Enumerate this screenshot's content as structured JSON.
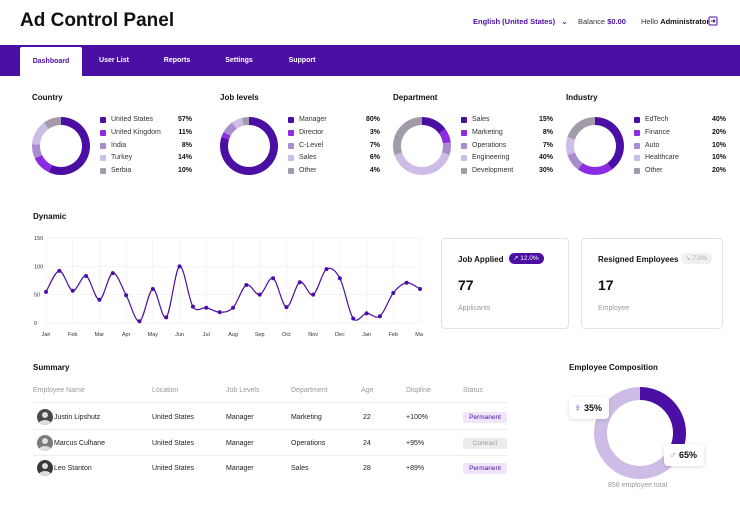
{
  "header": {
    "title": "Ad Control Panel",
    "language": "English (United States)",
    "balance_label": "Balance",
    "balance_value": "$0.00",
    "hello_label": "Hello",
    "user_name": "Administrator"
  },
  "nav": {
    "tabs": [
      {
        "label": "Dashboard",
        "active": true
      },
      {
        "label": "User List",
        "active": false
      },
      {
        "label": "Reports",
        "active": false
      },
      {
        "label": "Settings",
        "active": false
      },
      {
        "label": "Support",
        "active": false
      }
    ]
  },
  "colors": {
    "brand": "#4b0fa3",
    "c1": "#4b0fa3",
    "c2": "#8b2be2",
    "c3": "#a98bd0",
    "c4": "#cdbde6",
    "c5": "#a39ca8",
    "permanent_bg": "#efe6fb",
    "contract_bg": "#ececec"
  },
  "donuts": [
    {
      "title": "Country",
      "items": [
        {
          "label": "United States",
          "pct": "57%",
          "value": 57
        },
        {
          "label": "United Kingdom",
          "pct": "11%",
          "value": 11
        },
        {
          "label": "India",
          "pct": "8%",
          "value": 8
        },
        {
          "label": "Turkey",
          "pct": "14%",
          "value": 14
        },
        {
          "label": "Serbia",
          "pct": "10%",
          "value": 10
        }
      ]
    },
    {
      "title": "Job levels",
      "items": [
        {
          "label": "Manager",
          "pct": "80%",
          "value": 80
        },
        {
          "label": "Director",
          "pct": "3%",
          "value": 3
        },
        {
          "label": "C-Level",
          "pct": "7%",
          "value": 7
        },
        {
          "label": "Sales",
          "pct": "6%",
          "value": 6
        },
        {
          "label": "Other",
          "pct": "4%",
          "value": 4
        }
      ]
    },
    {
      "title": "Department",
      "items": [
        {
          "label": "Sales",
          "pct": "15%",
          "value": 15
        },
        {
          "label": "Marketing",
          "pct": "8%",
          "value": 8
        },
        {
          "label": "Operations",
          "pct": "7%",
          "value": 7
        },
        {
          "label": "Engineering",
          "pct": "40%",
          "value": 40
        },
        {
          "label": "Development",
          "pct": "30%",
          "value": 30
        }
      ]
    },
    {
      "title": "Industry",
      "items": [
        {
          "label": "EdTech",
          "pct": "40%",
          "value": 40
        },
        {
          "label": "Finance",
          "pct": "20%",
          "value": 20
        },
        {
          "label": "Auto",
          "pct": "10%",
          "value": 10
        },
        {
          "label": "Healthcare",
          "pct": "10%",
          "value": 10
        },
        {
          "label": "Other",
          "pct": "20%",
          "value": 20
        }
      ]
    }
  ],
  "chart_data": {
    "type": "line",
    "title": "Dynamic",
    "ylim": [
      0,
      150
    ],
    "yticks": [
      "150",
      "100",
      "50",
      "0"
    ],
    "xticks": [
      "Jan",
      "Feb",
      "Mar",
      "Apr",
      "May",
      "Jun",
      "Jul",
      "Aug",
      "Sep",
      "Oct",
      "Nov",
      "Dec",
      "Jan",
      "Feb",
      "Mar"
    ],
    "series": [
      {
        "values": [
          55,
          92,
          57,
          83,
          41,
          88,
          49,
          3,
          60,
          10,
          100,
          29,
          27,
          19,
          27,
          67,
          50,
          79,
          28,
          72,
          50,
          95,
          79,
          8,
          17,
          12,
          53,
          71,
          60
        ]
      }
    ]
  },
  "cards": {
    "job_applied": {
      "title": "Job Applied",
      "badge": "12.0%",
      "value": "77",
      "sub": "Applicants"
    },
    "resigned": {
      "title": "Resigned Employees",
      "badge": "7.0%",
      "value": "17",
      "sub": "Employee"
    }
  },
  "summary": {
    "title": "Summary",
    "columns": [
      "Employee Name",
      "Location",
      "Job Levels",
      "Department",
      "Age",
      "Displine",
      "Status"
    ],
    "rows": [
      {
        "name": "Justin Lipshutz",
        "location": "United States",
        "level": "Manager",
        "department": "Marketing",
        "age": "22",
        "discipline": "+100%",
        "status": "Permanent"
      },
      {
        "name": "Marcus Culhane",
        "location": "United States",
        "level": "Manager",
        "department": "Operations",
        "age": "24",
        "discipline": "+95%",
        "status": "Contract"
      },
      {
        "name": "Leo Stanton",
        "location": "United States",
        "level": "Manager",
        "department": "Sales",
        "age": "28",
        "discipline": "+89%",
        "status": "Permanent"
      }
    ]
  },
  "composition": {
    "title": "Employee Composition",
    "female_pct": "35%",
    "male_pct": "65%",
    "female_value": 35,
    "male_value": 65,
    "total": "856 employee total"
  }
}
